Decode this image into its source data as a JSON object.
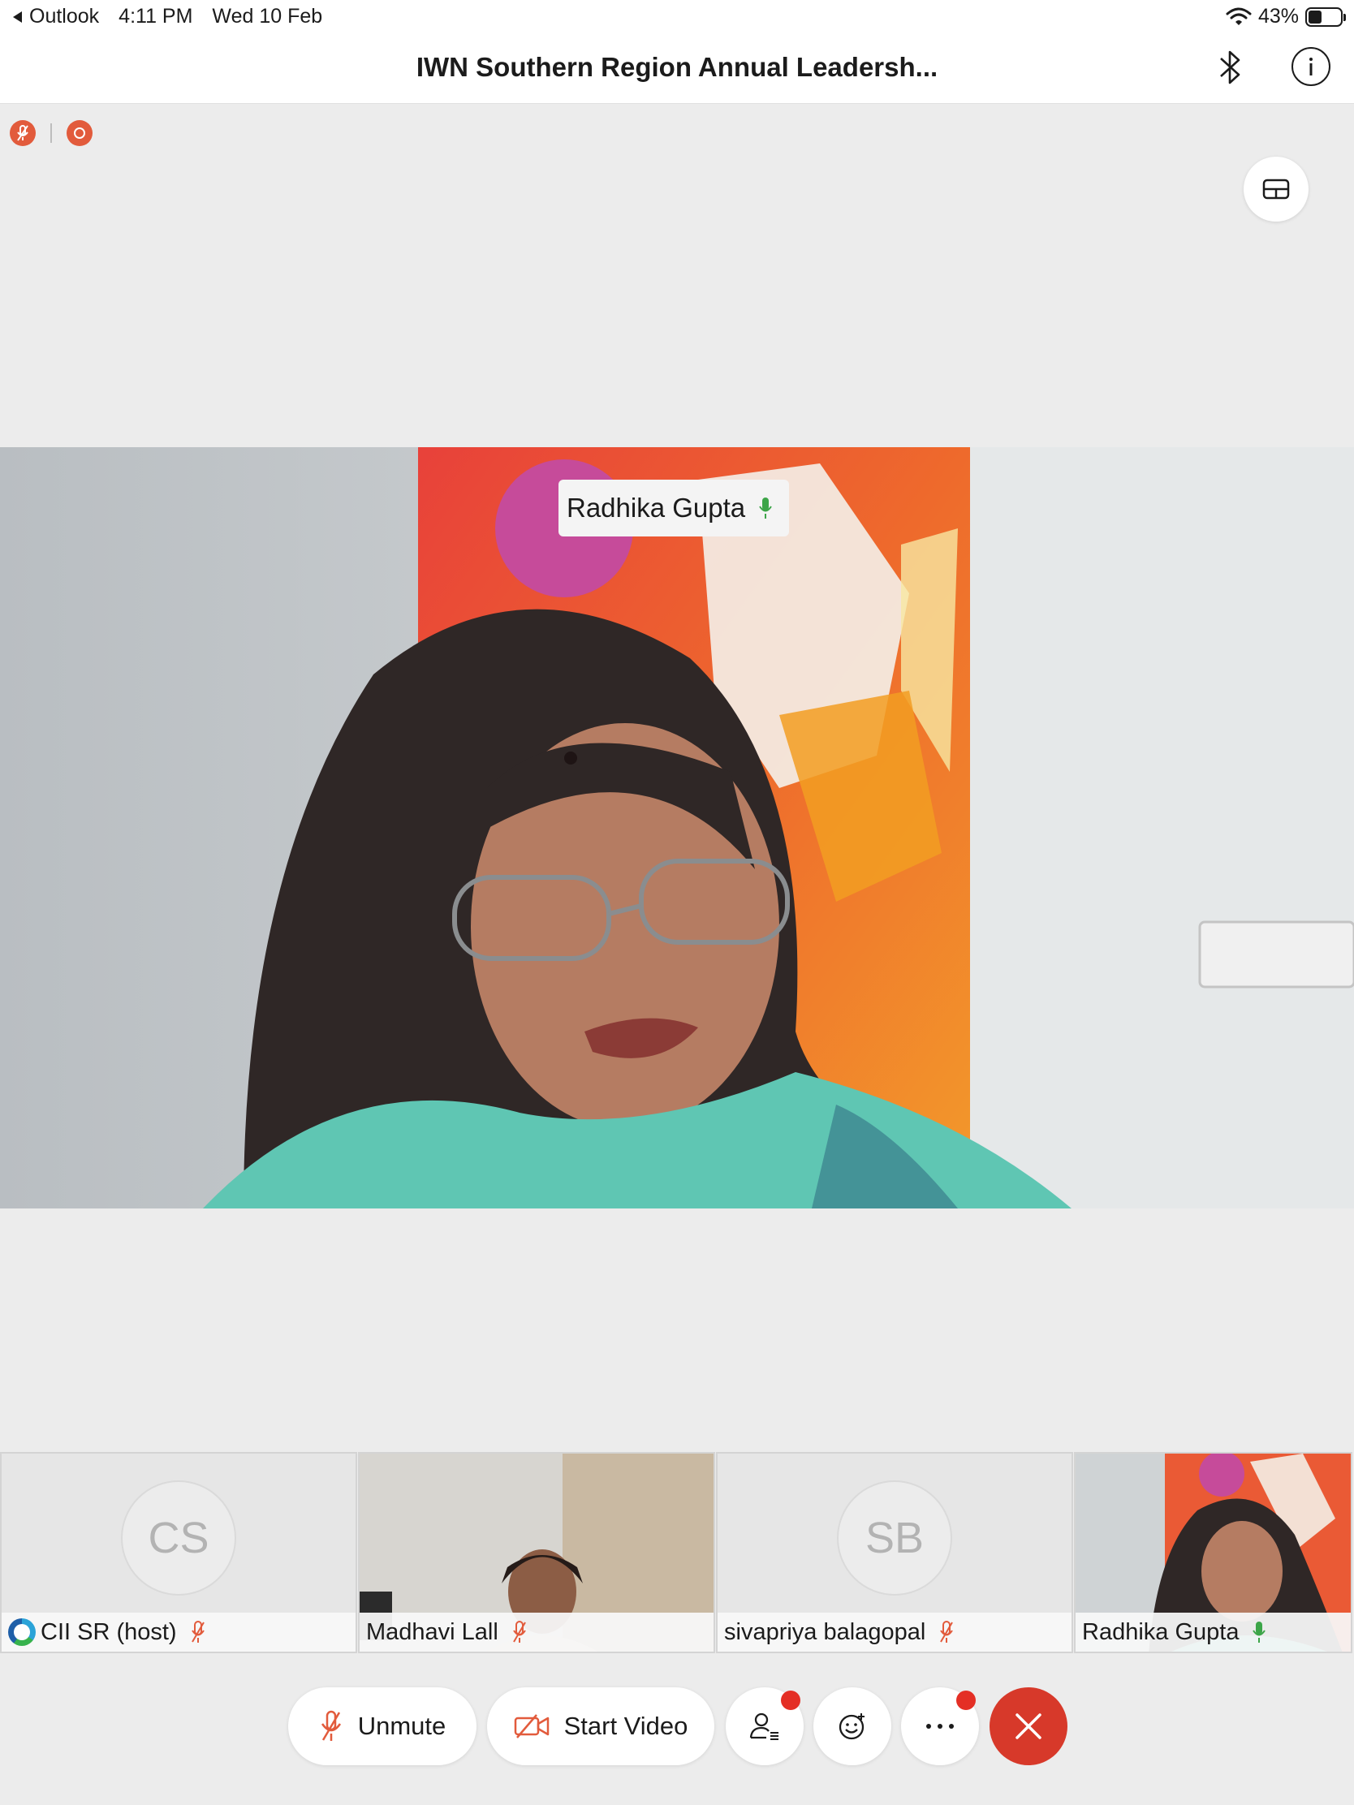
{
  "status_bar": {
    "back_app": "Outlook",
    "time": "4:11 PM",
    "date": "Wed 10 Feb",
    "battery": "43%",
    "battery_level": 0.43
  },
  "header": {
    "title": "IWN Southern Region Annual Leadersh..."
  },
  "main_video": {
    "speaker_name": "Radhika Gupta"
  },
  "participants": [
    {
      "initials": "CS",
      "name": "CII SR (host)",
      "muted": true
    },
    {
      "initials": "",
      "name": "Madhavi Lall",
      "muted": true
    },
    {
      "initials": "SB",
      "name": "sivapriya balagopal",
      "muted": true
    },
    {
      "initials": "",
      "name": "Radhika Gupta",
      "muted": false
    }
  ],
  "controls": {
    "unmute_label": "Unmute",
    "start_video_label": "Start Video"
  },
  "colors": {
    "muted_red": "#e25b3c",
    "mic_green": "#3ca548",
    "end_red": "#d7392a",
    "badge_red": "#e42f25"
  }
}
